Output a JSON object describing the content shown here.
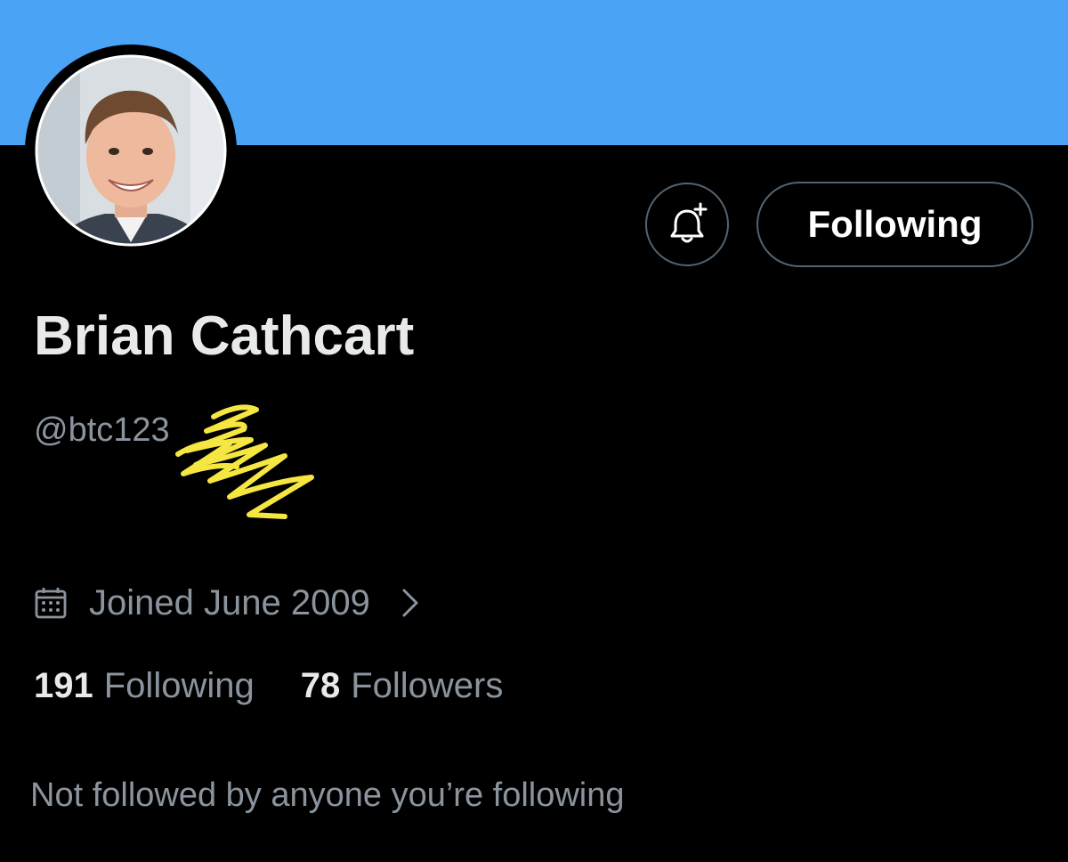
{
  "colors": {
    "banner": "#4ba3f5",
    "background": "#000000",
    "primary_text": "#e7e9ea",
    "secondary_text": "#8b949e",
    "button_border": "#536471",
    "scribble": "#f5e642"
  },
  "profile": {
    "display_name": "Brian Cathcart",
    "handle": "@btc123",
    "joined": "Joined June 2009",
    "following_count": "191",
    "following_label": "Following",
    "followers_count": "78",
    "followers_label": "Followers",
    "mutuals_note": "Not followed by anyone you’re following"
  },
  "actions": {
    "follow_state_label": "Following"
  },
  "icons": {
    "notify": "bell-plus-icon",
    "calendar": "calendar-icon",
    "chevron": "chevron-right-icon"
  }
}
